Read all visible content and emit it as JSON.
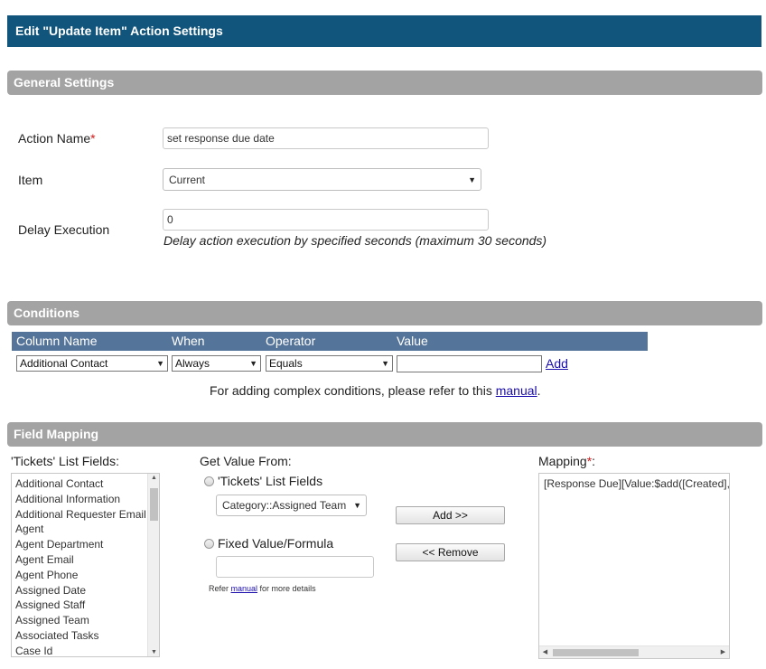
{
  "title": "Edit \"Update Item\" Action Settings",
  "general": {
    "heading": "General Settings",
    "action_name_label": "Action Name",
    "required_mark": "*",
    "action_name_value": "set response due date",
    "item_label": "Item",
    "item_value": "Current",
    "delay_label": "Delay Execution",
    "delay_value": "0",
    "delay_hint": "Delay action execution by specified seconds (maximum 30 seconds)"
  },
  "conditions": {
    "heading": "Conditions",
    "columns": [
      "Column Name",
      "When",
      "Operator",
      "Value"
    ],
    "column_value": "Additional Contact",
    "when_value": "Always",
    "operator_value": "Equals",
    "value_value": "",
    "add_label": "Add",
    "note_prefix": "For adding complex conditions, please refer to this ",
    "note_link": "manual",
    "note_suffix": "."
  },
  "field_mapping": {
    "heading": "Field Mapping",
    "list_label": "'Tickets' List Fields:",
    "list_items": [
      "Additional Contact",
      "Additional Information",
      "Additional Requester Email",
      "Agent",
      "Agent Department",
      "Agent Email",
      "Agent Phone",
      "Assigned Date",
      "Assigned Staff",
      "Assigned Team",
      "Associated Tasks",
      "Case Id"
    ],
    "get_value_label": "Get Value From:",
    "option_list_label": "'Tickets' List Fields",
    "option_list_value": "Category::Assigned Team",
    "option_fixed_label": "Fixed Value/Formula",
    "fixed_value": "",
    "refer_prefix": "Refer ",
    "refer_link": "manual",
    "refer_suffix": " for more details",
    "add_button": "Add >>",
    "remove_button": "<< Remove",
    "mapping_label": "Mapping",
    "mapping_colon": ":",
    "mapping_value": "[Response Due][Value:$add([Created],"
  },
  "colors": {
    "title_bg": "#11557c",
    "section_bg": "#a3a3a3",
    "table_header_bg": "#557499",
    "required": "#d01a1a",
    "link": "#1a0dab"
  }
}
